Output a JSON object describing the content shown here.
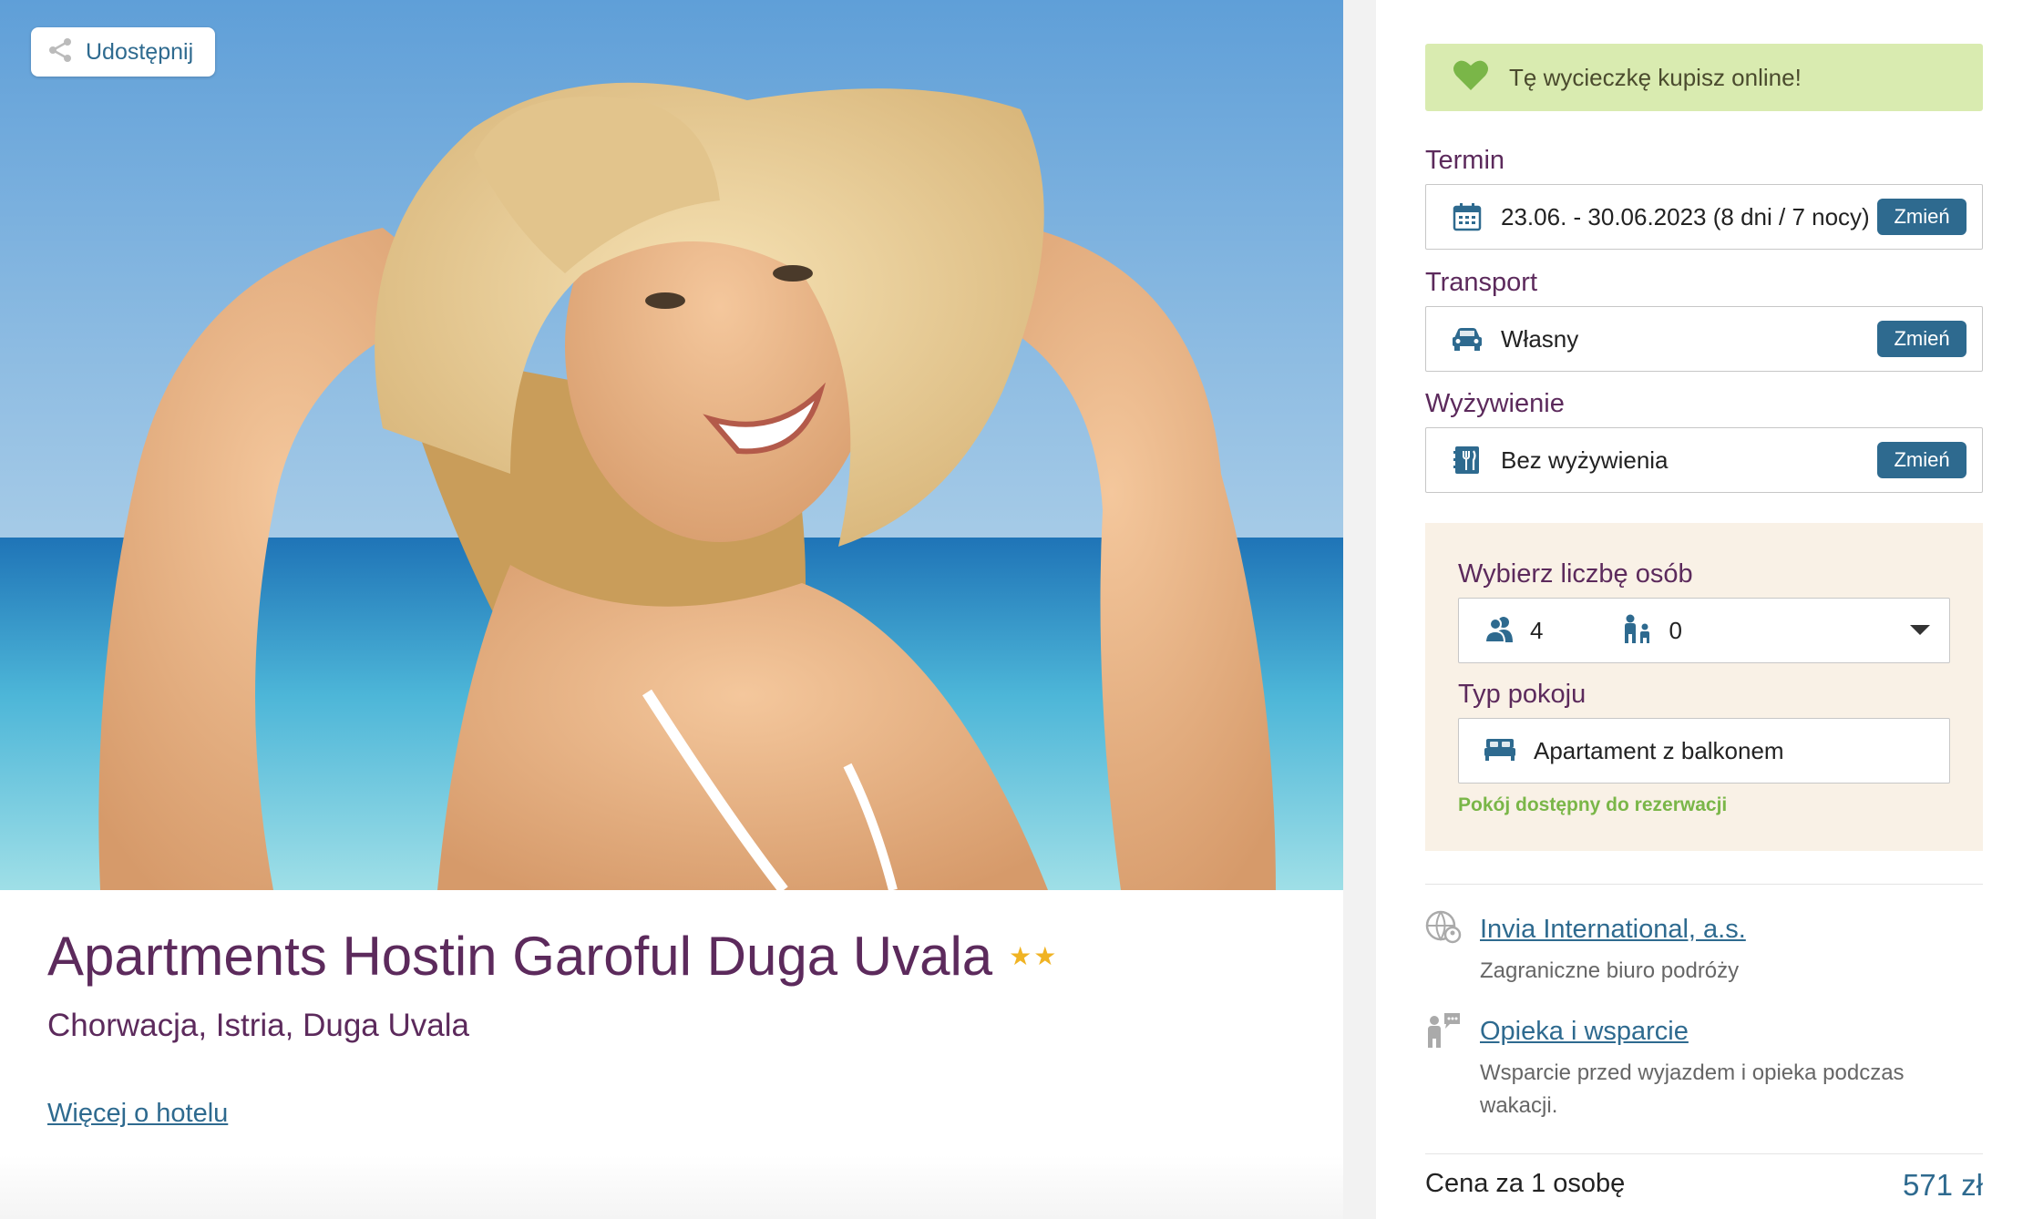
{
  "share": {
    "label": "Udostępnij",
    "icon": "share-icon"
  },
  "hotel": {
    "title": "Apartments Hostin Garoful Duga Uvala",
    "stars": "★★",
    "location": "Chorwacja, Istria, Duga Uvala",
    "more_link": "Więcej o hotelu"
  },
  "booking": {
    "banner": "Tę wycieczkę kupisz online!",
    "change_label": "Zmień",
    "term": {
      "label": "Termin",
      "value": "23.06. - 30.06.2023 (8 dni / 7 nocy)"
    },
    "transport": {
      "label": "Transport",
      "value": "Własny"
    },
    "board": {
      "label": "Wyżywienie",
      "value": "Bez wyżywienia"
    },
    "persons": {
      "label": "Wybierz liczbę osób",
      "adults": "4",
      "children": "0"
    },
    "room": {
      "label": "Typ pokoju",
      "value": "Apartament z balkonem",
      "availability": "Pokój dostępny do rezerwacji"
    }
  },
  "info": {
    "agency_link": "Invia International, a.s.",
    "agency_desc": "Zagraniczne biuro podróży",
    "support_link": "Opieka i wsparcie",
    "support_desc": "Wsparcie przed wyjazdem i opieka podczas wakacji."
  },
  "price": {
    "label": "Cena za 1 osobę",
    "value": "571 zł"
  },
  "colors": {
    "brand": "#5c2a5c",
    "accent": "#2e6a8f",
    "success": "#7ab648",
    "banner_bg": "#d9ebb0",
    "panel_bg": "#f9f1e6",
    "star": "#f0b323"
  }
}
